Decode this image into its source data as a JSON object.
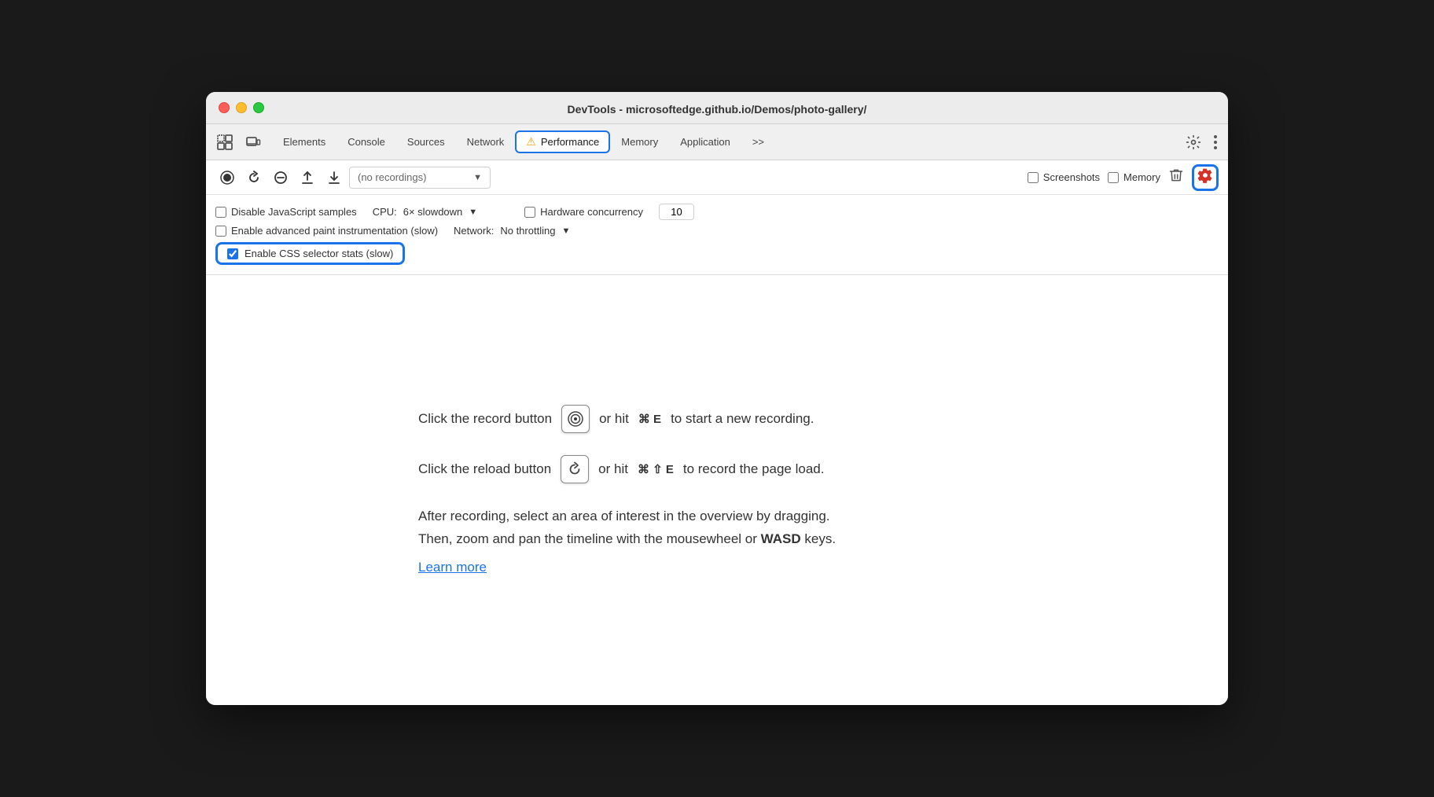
{
  "window": {
    "title": "DevTools - microsoftedge.github.io/Demos/photo-gallery/"
  },
  "tabs": {
    "items": [
      {
        "id": "elements",
        "label": "Elements"
      },
      {
        "id": "console",
        "label": "Console"
      },
      {
        "id": "sources",
        "label": "Sources"
      },
      {
        "id": "network",
        "label": "Network"
      },
      {
        "id": "performance",
        "label": "Performance",
        "active": true
      },
      {
        "id": "memory",
        "label": "Memory"
      },
      {
        "id": "application",
        "label": "Application"
      },
      {
        "id": "more",
        "label": ">>"
      }
    ]
  },
  "toolbar": {
    "recordings_placeholder": "(no recordings)",
    "screenshots_label": "Screenshots",
    "memory_label": "Memory"
  },
  "options": {
    "disable_js_samples": "Disable JavaScript samples",
    "enable_paint": "Enable advanced paint instrumentation (slow)",
    "enable_css_stats": "Enable CSS selector stats (slow)",
    "cpu_label": "CPU:",
    "cpu_value": "6× slowdown",
    "network_label": "Network:",
    "network_value": "No throttling",
    "hw_concurrency_label": "Hardware concurrency",
    "hw_concurrency_value": "10"
  },
  "instructions": {
    "record_line1": "Click the record button",
    "record_line2": "or hit",
    "record_shortcut": "⌘ E",
    "record_line3": "to start a new recording.",
    "reload_line1": "Click the reload button",
    "reload_line2": "or hit",
    "reload_shortcut": "⌘ ⇧ E",
    "reload_line3": "to record the page load.",
    "after_text1": "After recording, select an area of interest in the overview by dragging.",
    "after_text2": "Then, zoom and pan the timeline with the mousewheel or",
    "after_wasd": "WASD",
    "after_text3": "keys.",
    "learn_more": "Learn more"
  }
}
